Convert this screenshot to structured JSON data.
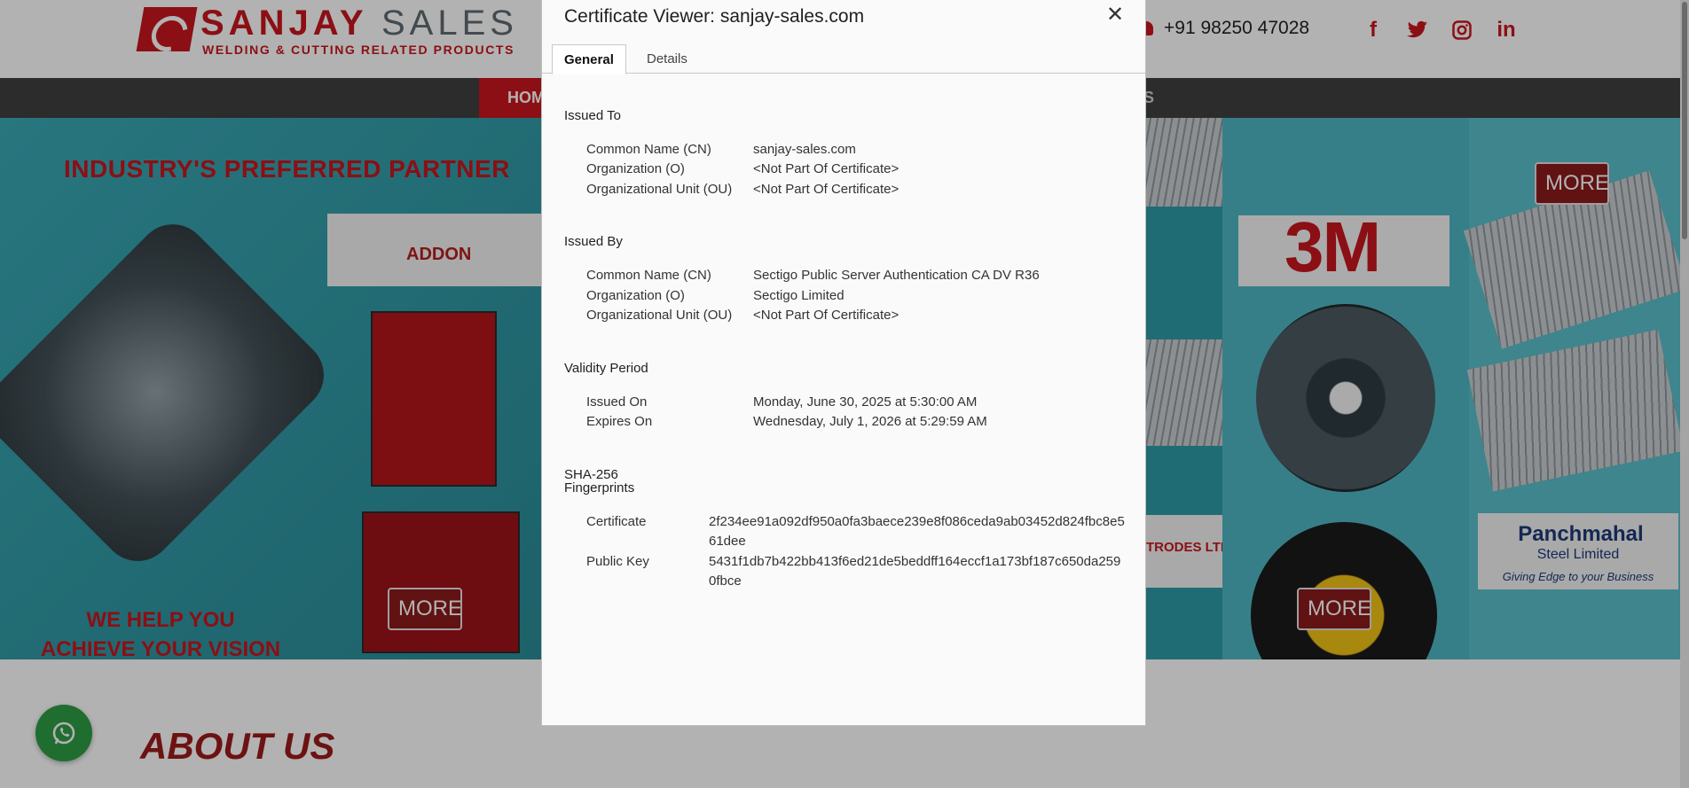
{
  "site": {
    "logo_name_a": "SANJAY",
    "logo_name_b": "SALES",
    "logo_tagline": "WELDING & CUTTING RELATED PRODUCTS",
    "phone": "+91 98250 47028",
    "social_icons": [
      "facebook-icon",
      "twitter-icon",
      "instagram-icon",
      "linkedin-icon"
    ],
    "nav_home": "HOM",
    "nav_us": "US",
    "banner_title": "INDUSTRY'S PREFERRED PARTNER",
    "banner_slogan_1": "WE HELP YOU",
    "banner_slogan_2": "ACHIEVE YOUR VISION",
    "addon_brand": "ADDON",
    "threem_brand": "3M",
    "electrodes_text": "TRODES LTD.",
    "panchmahal_brand": "Panchmahal",
    "panchmahal_sub_1": "Steel Limited",
    "panchmahal_tagline": "Giving Edge to your Business",
    "more_label": "MORE",
    "about_heading": "ABOUT US",
    "brand_color": "#c8161d"
  },
  "dialog": {
    "title": "Certificate Viewer: sanjay-sales.com",
    "close_icon": "close-icon",
    "tabs": [
      {
        "label": "General",
        "active": true
      },
      {
        "label": "Details",
        "active": false
      }
    ],
    "issued_to": {
      "heading": "Issued To",
      "rows": [
        {
          "label": "Common Name (CN)",
          "value": "sanjay-sales.com"
        },
        {
          "label": "Organization (O)",
          "value": "<Not Part Of Certificate>"
        },
        {
          "label": "Organizational Unit (OU)",
          "value": "<Not Part Of Certificate>"
        }
      ]
    },
    "issued_by": {
      "heading": "Issued By",
      "rows": [
        {
          "label": "Common Name (CN)",
          "value": "Sectigo Public Server Authentication CA DV R36"
        },
        {
          "label": "Organization (O)",
          "value": "Sectigo Limited"
        },
        {
          "label": "Organizational Unit (OU)",
          "value": "<Not Part Of Certificate>"
        }
      ]
    },
    "validity": {
      "heading": "Validity Period",
      "rows": [
        {
          "label": "Issued On",
          "value": "Monday, June 30, 2025 at 5:30:00 AM"
        },
        {
          "label": "Expires On",
          "value": "Wednesday, July 1, 2026 at 5:29:59 AM"
        }
      ]
    },
    "fingerprints": {
      "heading_1": "SHA-256",
      "heading_2": "Fingerprints",
      "rows": [
        {
          "label": "Certificate",
          "value": "2f234ee91a092df950a0fa3baece239e8f086ceda9ab03452d824fbc8e561dee"
        },
        {
          "label": "Public Key",
          "value": "5431f1db7b422bb413f6ed21de5beddff164eccf1a173bf187c650da2590fbce"
        }
      ]
    }
  }
}
